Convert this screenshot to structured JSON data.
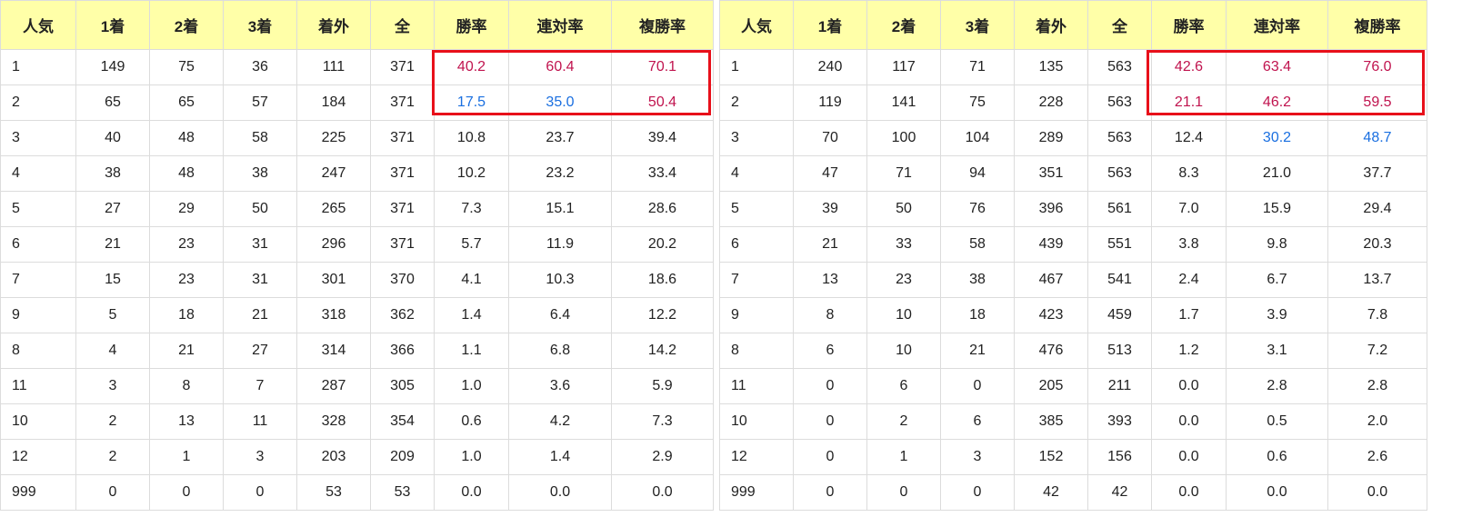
{
  "headers": [
    "人気",
    "1着",
    "2着",
    "3着",
    "着外",
    "全",
    "勝率",
    "連対率",
    "複勝率"
  ],
  "left_table": {
    "rows": [
      [
        "1",
        "149",
        "75",
        "36",
        "111",
        "371",
        "40.2",
        "60.4",
        "70.1"
      ],
      [
        "2",
        "65",
        "65",
        "57",
        "184",
        "371",
        "17.5",
        "35.0",
        "50.4"
      ],
      [
        "3",
        "40",
        "48",
        "58",
        "225",
        "371",
        "10.8",
        "23.7",
        "39.4"
      ],
      [
        "4",
        "38",
        "48",
        "38",
        "247",
        "371",
        "10.2",
        "23.2",
        "33.4"
      ],
      [
        "5",
        "27",
        "29",
        "50",
        "265",
        "371",
        "7.3",
        "15.1",
        "28.6"
      ],
      [
        "6",
        "21",
        "23",
        "31",
        "296",
        "371",
        "5.7",
        "11.9",
        "20.2"
      ],
      [
        "7",
        "15",
        "23",
        "31",
        "301",
        "370",
        "4.1",
        "10.3",
        "18.6"
      ],
      [
        "9",
        "5",
        "18",
        "21",
        "318",
        "362",
        "1.4",
        "6.4",
        "12.2"
      ],
      [
        "8",
        "4",
        "21",
        "27",
        "314",
        "366",
        "1.1",
        "6.8",
        "14.2"
      ],
      [
        "11",
        "3",
        "8",
        "7",
        "287",
        "305",
        "1.0",
        "3.6",
        "5.9"
      ],
      [
        "10",
        "2",
        "13",
        "11",
        "328",
        "354",
        "0.6",
        "4.2",
        "7.3"
      ],
      [
        "12",
        "2",
        "1",
        "3",
        "203",
        "209",
        "1.0",
        "1.4",
        "2.9"
      ],
      [
        "999",
        "0",
        "0",
        "0",
        "53",
        "53",
        "0.0",
        "0.0",
        "0.0"
      ]
    ],
    "cell_colors": [
      [
        null,
        null,
        null,
        null,
        null,
        null,
        "red",
        "red",
        "red"
      ],
      [
        null,
        null,
        null,
        null,
        null,
        null,
        "blue",
        "blue",
        "red"
      ]
    ]
  },
  "right_table": {
    "rows": [
      [
        "1",
        "240",
        "117",
        "71",
        "135",
        "563",
        "42.6",
        "63.4",
        "76.0"
      ],
      [
        "2",
        "119",
        "141",
        "75",
        "228",
        "563",
        "21.1",
        "46.2",
        "59.5"
      ],
      [
        "3",
        "70",
        "100",
        "104",
        "289",
        "563",
        "12.4",
        "30.2",
        "48.7"
      ],
      [
        "4",
        "47",
        "71",
        "94",
        "351",
        "563",
        "8.3",
        "21.0",
        "37.7"
      ],
      [
        "5",
        "39",
        "50",
        "76",
        "396",
        "561",
        "7.0",
        "15.9",
        "29.4"
      ],
      [
        "6",
        "21",
        "33",
        "58",
        "439",
        "551",
        "3.8",
        "9.8",
        "20.3"
      ],
      [
        "7",
        "13",
        "23",
        "38",
        "467",
        "541",
        "2.4",
        "6.7",
        "13.7"
      ],
      [
        "9",
        "8",
        "10",
        "18",
        "423",
        "459",
        "1.7",
        "3.9",
        "7.8"
      ],
      [
        "8",
        "6",
        "10",
        "21",
        "476",
        "513",
        "1.2",
        "3.1",
        "7.2"
      ],
      [
        "11",
        "0",
        "6",
        "0",
        "205",
        "211",
        "0.0",
        "2.8",
        "2.8"
      ],
      [
        "10",
        "0",
        "2",
        "6",
        "385",
        "393",
        "0.0",
        "0.5",
        "2.0"
      ],
      [
        "12",
        "0",
        "1",
        "3",
        "152",
        "156",
        "0.0",
        "0.6",
        "2.6"
      ],
      [
        "999",
        "0",
        "0",
        "0",
        "42",
        "42",
        "0.0",
        "0.0",
        "0.0"
      ]
    ],
    "cell_colors": [
      [
        null,
        null,
        null,
        null,
        null,
        null,
        "red",
        "red",
        "red"
      ],
      [
        null,
        null,
        null,
        null,
        null,
        null,
        "red",
        "red",
        "red"
      ],
      [
        null,
        null,
        null,
        null,
        null,
        null,
        null,
        "blue",
        "blue"
      ]
    ]
  },
  "colors": {
    "header_bg": "#ffffa8",
    "highlight_border": "#e8101a",
    "emphasis_red": "#c0134e",
    "emphasis_blue": "#1a6fe0"
  }
}
